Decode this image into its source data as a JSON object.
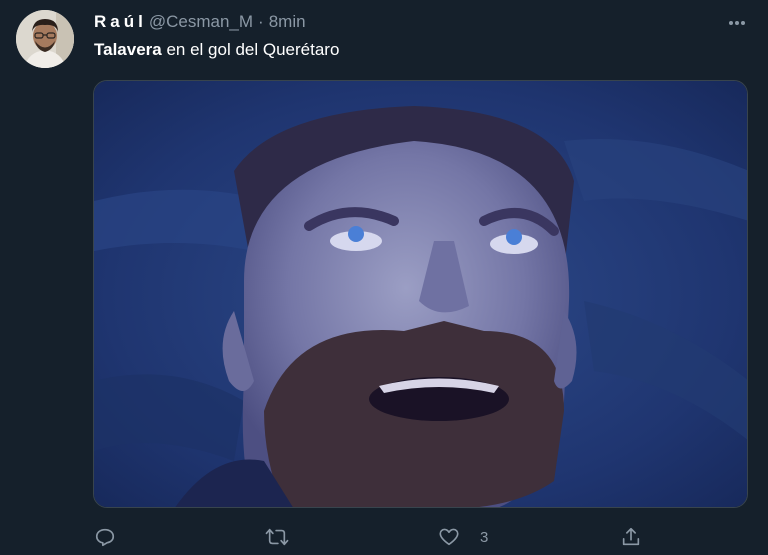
{
  "tweet": {
    "display_name": "Raúl",
    "handle": "@Cesman_M",
    "separator": "·",
    "time": "8min",
    "text_bold": "Talavera",
    "text_rest": " en el gol del Querétaro",
    "like_count": "3"
  },
  "icons": {
    "more": "more-horizontal-icon",
    "reply": "reply-icon",
    "retweet": "retweet-icon",
    "like": "heart-icon",
    "share": "share-icon"
  },
  "colors": {
    "background": "#15202b",
    "secondary_text": "#8b98a5",
    "border": "#38444d"
  }
}
